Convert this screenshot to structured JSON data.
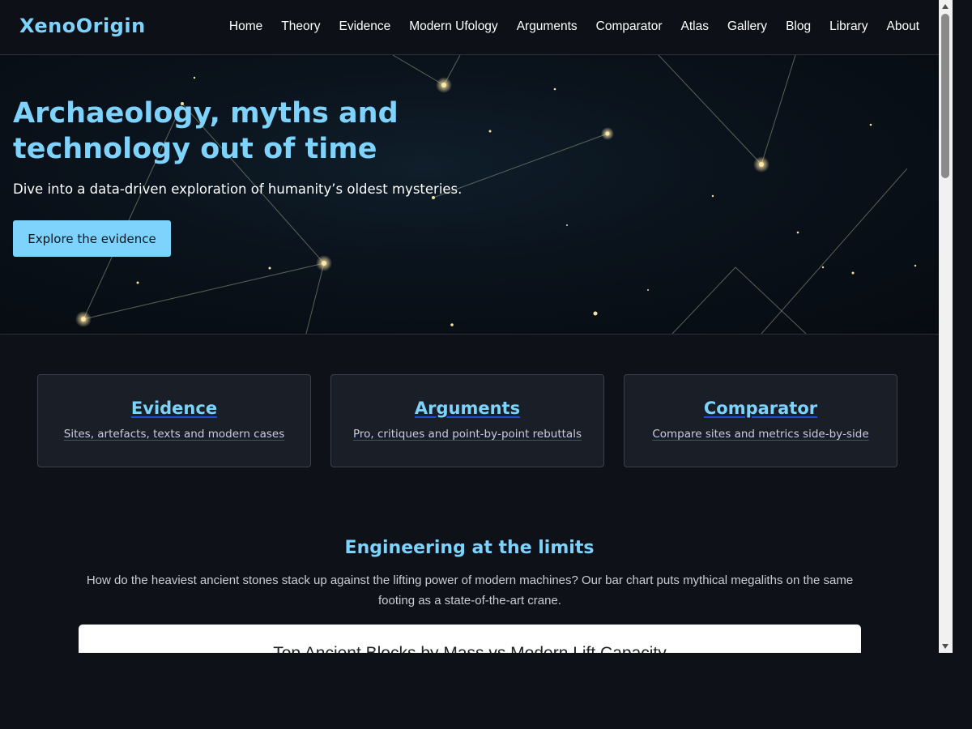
{
  "header": {
    "logo": "XenoOrigin",
    "nav": [
      "Home",
      "Theory",
      "Evidence",
      "Modern Ufology",
      "Arguments",
      "Comparator",
      "Atlas",
      "Gallery",
      "Blog",
      "Library",
      "About"
    ]
  },
  "hero": {
    "title": "Archaeology, myths and technology out of time",
    "subtitle": "Dive into a data-driven exploration of humanity’s oldest mysteries.",
    "cta": "Explore the evidence"
  },
  "cards": [
    {
      "title": "Evidence",
      "desc": "Sites, artefacts, texts and modern cases"
    },
    {
      "title": "Arguments",
      "desc": "Pro, critiques and point‑by‑point rebuttals"
    },
    {
      "title": "Comparator",
      "desc": "Compare sites and metrics side‑by‑side"
    }
  ],
  "section": {
    "title": "Engineering at the limits",
    "text": "How do the heaviest ancient stones stack up against the lifting power of modern machines? Our bar chart puts mythical megaliths on the same footing as a state-of-the-art crane.",
    "chart_title": "Top Ancient Blocks by Mass vs Modern Lift Capacity"
  },
  "colors": {
    "accent": "#7dd3fc",
    "background": "#0e1117",
    "card": "#1a1e27"
  }
}
